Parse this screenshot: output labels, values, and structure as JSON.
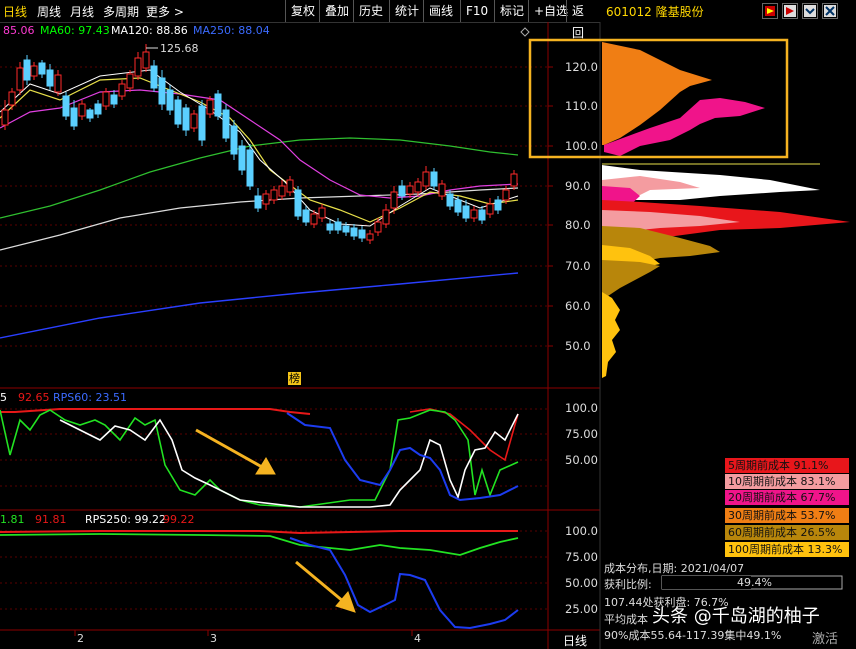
{
  "tabs": {
    "daily": "日线",
    "weekly": "周线",
    "monthly": "月线",
    "multi": "多周期",
    "more": "更多 >"
  },
  "toolbar": [
    "复权",
    "叠加",
    "历史",
    "统计",
    "画线",
    "F10",
    "标记",
    "+自选",
    "返回"
  ],
  "stock": {
    "code_name": "601012 隆基股份"
  },
  "ma": {
    "ma_partial": "85.06",
    "ma60": "MA60: 97.43",
    "ma120": "MA120: 88.86",
    "ma250": "MA250: 88.04"
  },
  "price_high_label": "125.68",
  "price_axis": [
    "120.0",
    "110.0",
    "100.0",
    "90.0",
    "80.0",
    "70.0",
    "60.0",
    "50.0"
  ],
  "badge": "榜",
  "rps1": {
    "prefix": "5",
    "v1": "92.65",
    "rps60": "RPS60: 23.51",
    "axis": [
      "100.0",
      "75.00",
      "50.00"
    ]
  },
  "rps2": {
    "prefix": "1.81",
    "v1": "91.81",
    "rps250": "RPS250: 99.22",
    "v2": "99.22",
    "axis": [
      "100.0",
      "75.00",
      "50.00",
      "25.00"
    ]
  },
  "months": [
    "2",
    "3",
    "4"
  ],
  "bottom_tab": "日线",
  "cost_legend": [
    {
      "text": "5周期前成本 91.1%",
      "color": "#e8161b"
    },
    {
      "text": "10周期前成本 83.1%",
      "color": "#f49ca0"
    },
    {
      "text": "20周期前成本 67.7%",
      "color": "#f0148a"
    },
    {
      "text": "30周期前成本 53.7%",
      "color": "#f07e14"
    },
    {
      "text": "60周期前成本 26.5%",
      "color": "#b8860b"
    },
    {
      "text": "100周期前成本 13.3%",
      "color": "#ffc20e"
    }
  ],
  "cost_info": {
    "date": "成本分布,日期: 2021/04/07",
    "profit_label": "获利比例:",
    "profit_value": "49.4%",
    "profit_ratio": 0.494,
    "profit_line": "107.44处获利盘: 76.7%",
    "avg": "平均成本",
    "range90": "90%成本55.64-117.39集中49.1%"
  },
  "watermark": {
    "main": "头条 @千岛湖的柚子",
    "sub": "激活"
  }
}
